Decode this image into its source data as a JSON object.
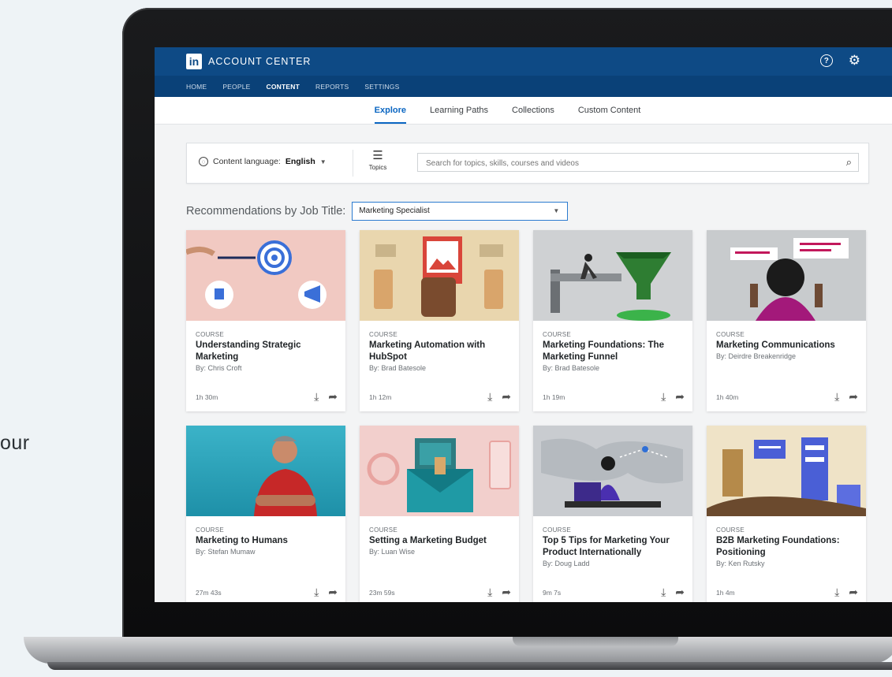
{
  "background_text": "our",
  "header": {
    "logo_text": "in",
    "app_title": "ACCOUNT CENTER",
    "help_icon": "question-circle-icon",
    "settings_icon": "gear-icon"
  },
  "nav": {
    "items": [
      "HOME",
      "PEOPLE",
      "CONTENT",
      "REPORTS",
      "SETTINGS"
    ],
    "active": "CONTENT"
  },
  "subtabs": {
    "items": [
      "Explore",
      "Learning Paths",
      "Collections",
      "Custom Content"
    ],
    "active": "Explore"
  },
  "filter": {
    "language_label": "Content language:",
    "language_value": "English",
    "topics_label": "Topics",
    "search_placeholder": "Search for topics, skills, courses and videos"
  },
  "recommendations": {
    "label": "Recommendations by Job Title:",
    "selected": "Marketing Specialist"
  },
  "colors": {
    "brand": "#0e4a85",
    "nav_bg": "#0a4178",
    "accent": "#0a66c2"
  },
  "cards": [
    {
      "kind": "COURSE",
      "title": "Understanding Strategic Marketing",
      "author": "By: Chris Croft",
      "duration": "1h 30m"
    },
    {
      "kind": "COURSE",
      "title": "Marketing Automation with HubSpot",
      "author": "By: Brad Batesole",
      "duration": "1h 12m"
    },
    {
      "kind": "COURSE",
      "title": "Marketing Foundations: The Marketing Funnel",
      "author": "By: Brad Batesole",
      "duration": "1h 19m"
    },
    {
      "kind": "COURSE",
      "title": "Marketing Communications",
      "author": "By: Deirdre Breakenridge",
      "duration": "1h 40m"
    },
    {
      "kind": "COURSE",
      "title": "Marketing to Humans",
      "author": "By: Stefan Mumaw",
      "duration": "27m 43s"
    },
    {
      "kind": "COURSE",
      "title": "Setting a Marketing Budget",
      "author": "By: Luan Wise",
      "duration": "23m 59s"
    },
    {
      "kind": "COURSE",
      "title": "Top 5 Tips for Marketing Your Product Internationally",
      "author": "By: Doug Ladd",
      "duration": "9m 7s"
    },
    {
      "kind": "COURSE",
      "title": "B2B Marketing Foundations: Positioning",
      "author": "By: Ken Rutsky",
      "duration": "1h 4m"
    }
  ]
}
